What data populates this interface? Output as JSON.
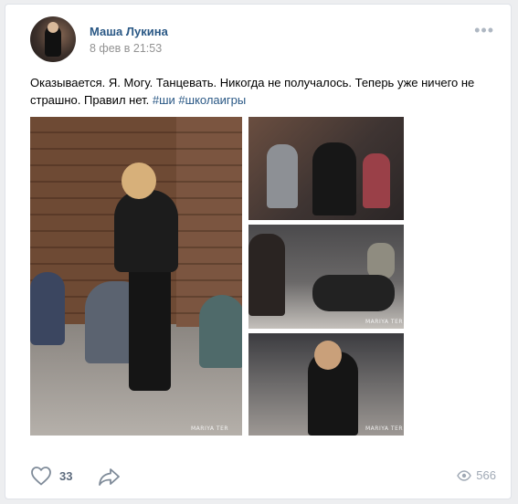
{
  "post": {
    "author": "Маша Лукина",
    "date": "8 фев в 21:53",
    "more_icon": "more-dots-icon",
    "text_main": "Оказывается. Я. Могу. Танцевать. Никогда не получалось. Теперь уже ничего не страшно. Правил нет. ",
    "hashtag1": "#ши",
    "hashtag2": "#школаигры",
    "watermark": "MARIYA TER"
  },
  "actions": {
    "like_icon": "heart-icon",
    "likes": "33",
    "share_icon": "share-icon",
    "views_icon": "eye-icon",
    "views": "566"
  },
  "colors": {
    "link": "#2a5885",
    "muted": "#939393",
    "action": "#5d6b7d"
  }
}
